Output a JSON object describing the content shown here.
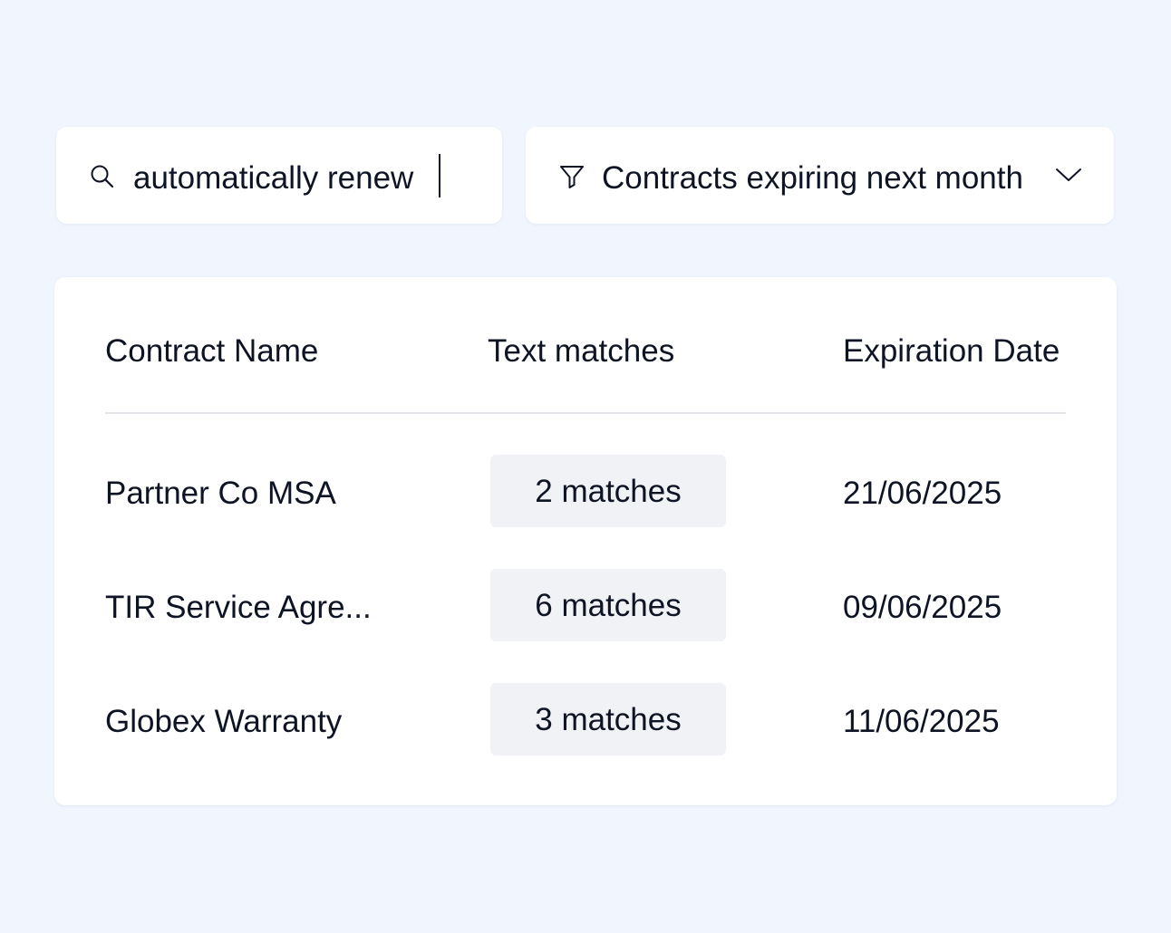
{
  "search": {
    "value": "automatically renew",
    "icon": "search-icon"
  },
  "filter": {
    "label": "Contracts expiring next month",
    "icon": "filter-icon",
    "dropdown_icon": "chevron-down-icon"
  },
  "table": {
    "columns": [
      "Contract Name",
      "Text matches",
      "Expiration Date"
    ],
    "rows": [
      {
        "name": "Partner Co MSA",
        "matches": "2 matches",
        "date": "21/06/2025"
      },
      {
        "name": "TIR Service Agre...",
        "matches": "6 matches",
        "date": "09/06/2025"
      },
      {
        "name": "Globex Warranty",
        "matches": "3 matches",
        "date": "11/06/2025"
      }
    ]
  },
  "colors": {
    "background": "#f0f5fe",
    "card": "#ffffff",
    "text": "#0e1424",
    "pill": "#f1f2f6",
    "divider": "#e3e5ea"
  }
}
